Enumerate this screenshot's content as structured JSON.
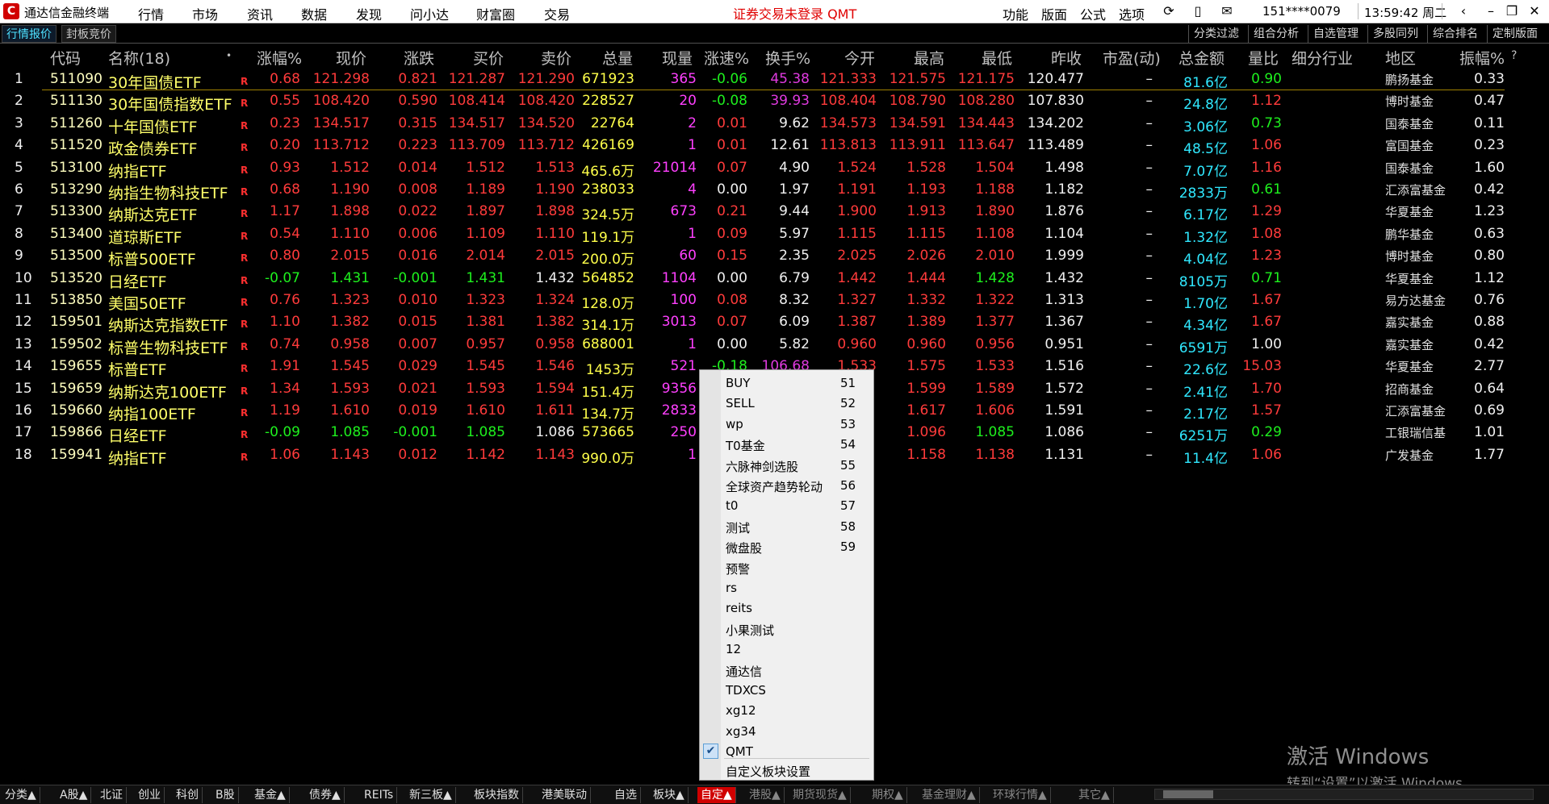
{
  "app": {
    "title": "通达信金融终端",
    "menus": [
      "行情",
      "市场",
      "资讯",
      "数据",
      "发现",
      "问小达",
      "财富圈",
      "交易"
    ],
    "notice": "证券交易未登录  QMT",
    "right_menus": [
      "功能",
      "版面",
      "公式",
      "选项"
    ],
    "account": "151****0079",
    "clock": "13:59:42 周二"
  },
  "tabs": [
    "行情报价",
    "封板竞价"
  ],
  "right_buttons": [
    "分类过滤",
    "组合分析",
    "自选管理",
    "多股同列",
    "综合排名",
    "定制版面"
  ],
  "columns": [
    "代码",
    "名称(18)",
    "涨幅%",
    "现价",
    "涨跌",
    "买价",
    "卖价",
    "总量",
    "现量",
    "涨速%",
    "换手%",
    "今开",
    "最高",
    "最低",
    "昨收",
    "市盈(动)",
    "总金额",
    "量比",
    "细分行业",
    "地区",
    "振幅%"
  ],
  "column_extra": "?",
  "rows": [
    {
      "idx": "1",
      "code": "511090",
      "name": "30年国债ETF",
      "flag": "R",
      "chg": "0.68",
      "price": "121.298",
      "delta": "0.821",
      "bid": "121.287",
      "ask": "121.290",
      "vol": "671923",
      "cur": "365",
      "speed": "-0.06",
      "turn": "45.38",
      "open": "121.333",
      "high": "121.575",
      "low": "121.175",
      "prev": "120.477",
      "pe": "–",
      "amt": "81.6亿",
      "ratio": "0.90",
      "region": "鹏扬基金",
      "amp": "0.33"
    },
    {
      "idx": "2",
      "code": "511130",
      "name": "30年国债指数ETF",
      "flag": "R",
      "chg": "0.55",
      "price": "108.420",
      "delta": "0.590",
      "bid": "108.414",
      "ask": "108.420",
      "vol": "228527",
      "cur": "20",
      "speed": "-0.08",
      "turn": "39.93",
      "open": "108.404",
      "high": "108.790",
      "low": "108.280",
      "prev": "107.830",
      "pe": "–",
      "amt": "24.8亿",
      "ratio": "1.12",
      "region": "博时基金",
      "amp": "0.47"
    },
    {
      "idx": "3",
      "code": "511260",
      "name": "十年国债ETF",
      "flag": "R",
      "chg": "0.23",
      "price": "134.517",
      "delta": "0.315",
      "bid": "134.517",
      "ask": "134.520",
      "vol": "22764",
      "cur": "2",
      "speed": "0.01",
      "turn": "9.62",
      "open": "134.573",
      "high": "134.591",
      "low": "134.443",
      "prev": "134.202",
      "pe": "–",
      "amt": "3.06亿",
      "ratio": "0.73",
      "region": "国泰基金",
      "amp": "0.11"
    },
    {
      "idx": "4",
      "code": "511520",
      "name": "政金债券ETF",
      "flag": "R",
      "chg": "0.20",
      "price": "113.712",
      "delta": "0.223",
      "bid": "113.709",
      "ask": "113.712",
      "vol": "426169",
      "cur": "1",
      "speed": "0.01",
      "turn": "12.61",
      "open": "113.813",
      "high": "113.911",
      "low": "113.647",
      "prev": "113.489",
      "pe": "–",
      "amt": "48.5亿",
      "ratio": "1.06",
      "region": "富国基金",
      "amp": "0.23"
    },
    {
      "idx": "5",
      "code": "513100",
      "name": "纳指ETF",
      "flag": "R",
      "chg": "0.93",
      "price": "1.512",
      "delta": "0.014",
      "bid": "1.512",
      "ask": "1.513",
      "vol": "465.6万",
      "cur": "21014",
      "speed": "0.07",
      "turn": "4.90",
      "open": "1.524",
      "high": "1.528",
      "low": "1.504",
      "prev": "1.498",
      "pe": "–",
      "amt": "7.07亿",
      "ratio": "1.16",
      "region": "国泰基金",
      "amp": "1.60"
    },
    {
      "idx": "6",
      "code": "513290",
      "name": "纳指生物科技ETF",
      "flag": "R",
      "chg": "0.68",
      "price": "1.190",
      "delta": "0.008",
      "bid": "1.189",
      "ask": "1.190",
      "vol": "238033",
      "cur": "4",
      "speed": "0.00",
      "turn": "1.97",
      "open": "1.191",
      "high": "1.193",
      "low": "1.188",
      "prev": "1.182",
      "pe": "–",
      "amt": "2833万",
      "ratio": "0.61",
      "region": "汇添富基金",
      "amp": "0.42"
    },
    {
      "idx": "7",
      "code": "513300",
      "name": "纳斯达克ETF",
      "flag": "R",
      "chg": "1.17",
      "price": "1.898",
      "delta": "0.022",
      "bid": "1.897",
      "ask": "1.898",
      "vol": "324.5万",
      "cur": "673",
      "speed": "0.21",
      "turn": "9.44",
      "open": "1.900",
      "high": "1.913",
      "low": "1.890",
      "prev": "1.876",
      "pe": "–",
      "amt": "6.17亿",
      "ratio": "1.29",
      "region": "华夏基金",
      "amp": "1.23"
    },
    {
      "idx": "8",
      "code": "513400",
      "name": "道琼斯ETF",
      "flag": "R",
      "chg": "0.54",
      "price": "1.110",
      "delta": "0.006",
      "bid": "1.109",
      "ask": "1.110",
      "vol": "119.1万",
      "cur": "1",
      "speed": "0.09",
      "turn": "5.97",
      "open": "1.115",
      "high": "1.115",
      "low": "1.108",
      "prev": "1.104",
      "pe": "–",
      "amt": "1.32亿",
      "ratio": "1.08",
      "region": "鹏华基金",
      "amp": "0.63"
    },
    {
      "idx": "9",
      "code": "513500",
      "name": "标普500ETF",
      "flag": "R",
      "chg": "0.80",
      "price": "2.015",
      "delta": "0.016",
      "bid": "2.014",
      "ask": "2.015",
      "vol": "200.0万",
      "cur": "60",
      "speed": "0.15",
      "turn": "2.35",
      "open": "2.025",
      "high": "2.026",
      "low": "2.010",
      "prev": "1.999",
      "pe": "–",
      "amt": "4.04亿",
      "ratio": "1.23",
      "region": "博时基金",
      "amp": "0.80"
    },
    {
      "idx": "10",
      "code": "513520",
      "name": "日经ETF",
      "flag": "R",
      "chg": "-0.07",
      "price": "1.431",
      "delta": "-0.001",
      "bid": "1.431",
      "ask": "1.432",
      "vol": "564852",
      "cur": "1104",
      "speed": "0.00",
      "turn": "6.79",
      "open": "1.442",
      "high": "1.444",
      "low": "1.428",
      "prev": "1.432",
      "pe": "–",
      "amt": "8105万",
      "ratio": "0.71",
      "region": "华夏基金",
      "amp": "1.12"
    },
    {
      "idx": "11",
      "code": "513850",
      "name": "美国50ETF",
      "flag": "R",
      "chg": "0.76",
      "price": "1.323",
      "delta": "0.010",
      "bid": "1.323",
      "ask": "1.324",
      "vol": "128.0万",
      "cur": "100",
      "speed": "0.08",
      "turn": "8.32",
      "open": "1.327",
      "high": "1.332",
      "low": "1.322",
      "prev": "1.313",
      "pe": "–",
      "amt": "1.70亿",
      "ratio": "1.67",
      "region": "易方达基金",
      "amp": "0.76"
    },
    {
      "idx": "12",
      "code": "159501",
      "name": "纳斯达克指数ETF",
      "flag": "R",
      "chg": "1.10",
      "price": "1.382",
      "delta": "0.015",
      "bid": "1.381",
      "ask": "1.382",
      "vol": "314.1万",
      "cur": "3013",
      "speed": "0.07",
      "turn": "6.09",
      "open": "1.387",
      "high": "1.389",
      "low": "1.377",
      "prev": "1.367",
      "pe": "–",
      "amt": "4.34亿",
      "ratio": "1.67",
      "region": "嘉实基金",
      "amp": "0.88"
    },
    {
      "idx": "13",
      "code": "159502",
      "name": "标普生物科技ETF",
      "flag": "R",
      "chg": "0.74",
      "price": "0.958",
      "delta": "0.007",
      "bid": "0.957",
      "ask": "0.958",
      "vol": "688001",
      "cur": "1",
      "speed": "0.00",
      "turn": "5.82",
      "open": "0.960",
      "high": "0.960",
      "low": "0.956",
      "prev": "0.951",
      "pe": "–",
      "amt": "6591万",
      "ratio": "1.00",
      "region": "嘉实基金",
      "amp": "0.42"
    },
    {
      "idx": "14",
      "code": "159655",
      "name": "标普ETF",
      "flag": "R",
      "chg": "1.91",
      "price": "1.545",
      "delta": "0.029",
      "bid": "1.545",
      "ask": "1.546",
      "vol": "1453万",
      "cur": "521",
      "speed": "-0.18",
      "turn": "106.68",
      "open": "1.533",
      "high": "1.575",
      "low": "1.533",
      "prev": "1.516",
      "pe": "–",
      "amt": "22.6亿",
      "ratio": "15.03",
      "region": "华夏基金",
      "amp": "2.77"
    },
    {
      "idx": "15",
      "code": "159659",
      "name": "纳斯达克100ETF",
      "flag": "R",
      "chg": "1.34",
      "price": "1.593",
      "delta": "0.021",
      "bid": "1.593",
      "ask": "1.594",
      "vol": "151.4万",
      "cur": "9356",
      "speed": "",
      "turn": "",
      "open": "",
      "high": "1.599",
      "low": "1.589",
      "prev": "1.572",
      "pe": "–",
      "amt": "2.41亿",
      "ratio": "1.70",
      "region": "招商基金",
      "amp": "0.64"
    },
    {
      "idx": "16",
      "code": "159660",
      "name": "纳指100ETF",
      "flag": "R",
      "chg": "1.19",
      "price": "1.610",
      "delta": "0.019",
      "bid": "1.610",
      "ask": "1.611",
      "vol": "134.7万",
      "cur": "2833",
      "speed": "",
      "turn": "",
      "open": "",
      "high": "1.617",
      "low": "1.606",
      "prev": "1.591",
      "pe": "–",
      "amt": "2.17亿",
      "ratio": "1.57",
      "region": "汇添富基金",
      "amp": "0.69"
    },
    {
      "idx": "17",
      "code": "159866",
      "name": "日经ETF",
      "flag": "R",
      "chg": "-0.09",
      "price": "1.085",
      "delta": "-0.001",
      "bid": "1.085",
      "ask": "1.086",
      "vol": "573665",
      "cur": "250",
      "speed": "",
      "turn": "",
      "open": "",
      "high": "1.096",
      "low": "1.085",
      "prev": "1.086",
      "pe": "–",
      "amt": "6251万",
      "ratio": "0.29",
      "region": "工银瑞信基",
      "amp": "1.01"
    },
    {
      "idx": "18",
      "code": "159941",
      "name": "纳指ETF",
      "flag": "R",
      "chg": "1.06",
      "price": "1.143",
      "delta": "0.012",
      "bid": "1.142",
      "ask": "1.143",
      "vol": "990.0万",
      "cur": "1",
      "speed": "",
      "turn": "",
      "open": "",
      "high": "1.158",
      "low": "1.138",
      "prev": "1.131",
      "pe": "–",
      "amt": "11.4亿",
      "ratio": "1.06",
      "region": "广发基金",
      "amp": "1.77"
    }
  ],
  "popup": {
    "items": [
      {
        "label": "BUY",
        "num": "51"
      },
      {
        "label": "SELL",
        "num": "52"
      },
      {
        "label": "wp",
        "num": "53"
      },
      {
        "label": "T0基金",
        "num": "54"
      },
      {
        "label": "六脉神剑选股",
        "num": "55"
      },
      {
        "label": "全球资产趋势轮动",
        "num": "56"
      },
      {
        "label": "t0",
        "num": "57"
      },
      {
        "label": "测试",
        "num": "58"
      },
      {
        "label": "微盘股",
        "num": "59"
      },
      {
        "label": "预警",
        "num": ""
      },
      {
        "label": "rs",
        "num": ""
      },
      {
        "label": "reits",
        "num": ""
      },
      {
        "label": "小果测试",
        "num": ""
      },
      {
        "label": "12",
        "num": ""
      },
      {
        "label": "通达信",
        "num": ""
      },
      {
        "label": "TDXCS",
        "num": ""
      },
      {
        "label": "xg12",
        "num": ""
      },
      {
        "label": "xg34",
        "num": ""
      },
      {
        "label": "QMT",
        "num": "",
        "checked": true
      }
    ],
    "footer": "自定义板块设置"
  },
  "bottom_tabs": [
    "分类▲",
    "A股▲",
    "北证",
    "创业",
    "科创",
    "B股",
    "基金▲",
    "债券▲",
    "REITs",
    "新三板▲",
    "板块指数",
    "港美联动",
    "自选",
    "板块▲",
    "自定▲",
    "港股▲",
    "期货现货▲",
    "期权▲",
    "基金理财▲",
    "环球行情▲",
    "其它▲"
  ],
  "watermark": {
    "line1": "激活 Windows",
    "line2": "转到“设置”以激活 Windows。"
  },
  "colors": {
    "up": "#ff3b3b",
    "down": "#1ef01e",
    "name": "#ffff6a",
    "amount": "#30e8ff",
    "active_tab": "#d00000"
  }
}
